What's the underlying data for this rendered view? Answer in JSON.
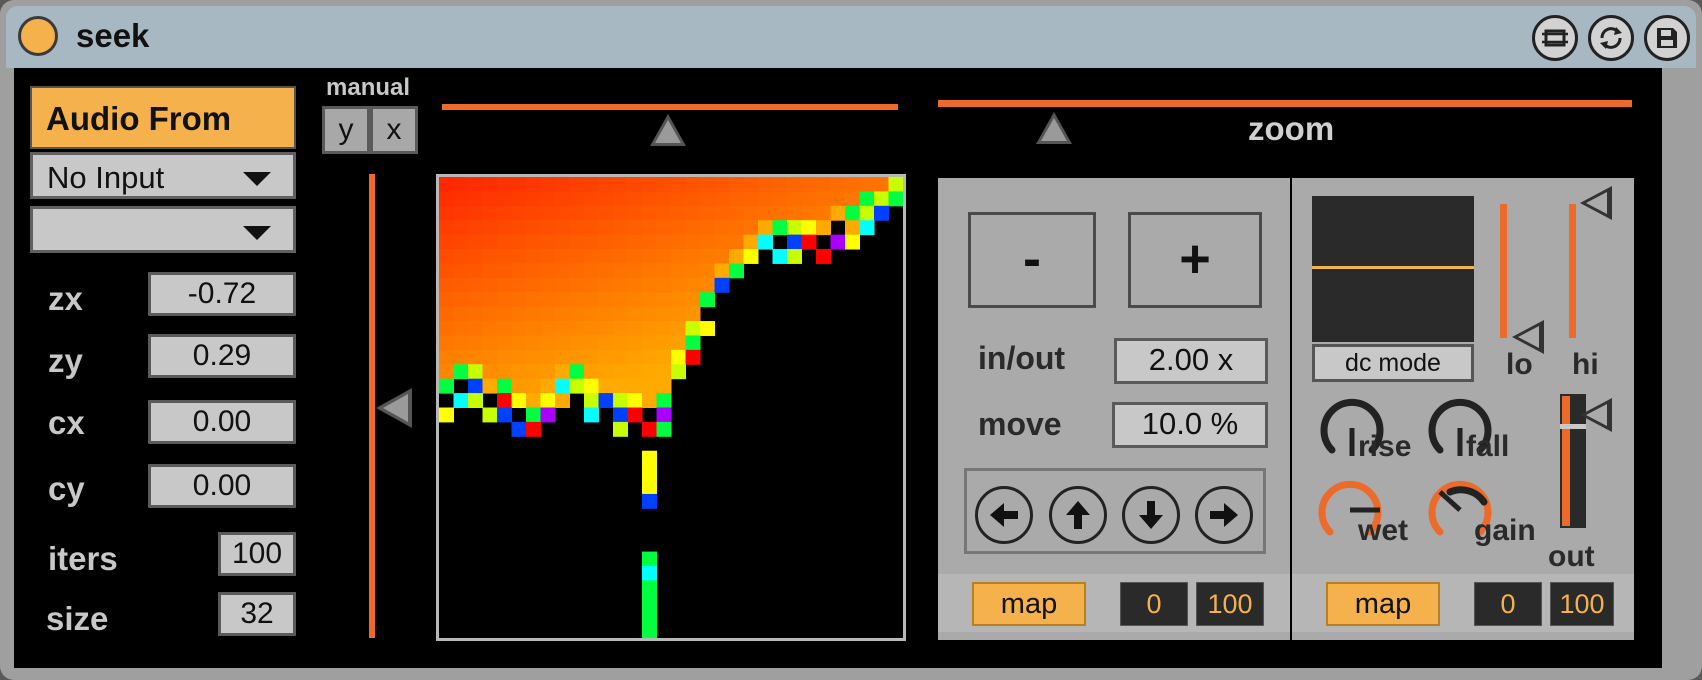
{
  "device": {
    "title": "seek"
  },
  "titlebar": {
    "icons": [
      "hot-swap-icon",
      "presets-icon",
      "save-icon"
    ]
  },
  "source": {
    "header": "Audio From",
    "input_menu": "No Input",
    "channel_menu": ""
  },
  "params": {
    "zx": {
      "label": "zx",
      "value": "-0.72"
    },
    "zy": {
      "label": "zy",
      "value": "0.29"
    },
    "cx": {
      "label": "cx",
      "value": "0.00"
    },
    "cy": {
      "label": "cy",
      "value": "0.00"
    },
    "iters": {
      "label": "iters",
      "value": "100"
    },
    "size": {
      "label": "size",
      "value": "32"
    }
  },
  "manual": {
    "label": "manual",
    "y_label": "y",
    "x_label": "x"
  },
  "zoom": {
    "label": "zoom",
    "minus_label": "-",
    "plus_label": "+",
    "inout_label": "in/out",
    "inout_value": "2.00 x",
    "move_label": "move",
    "move_value": "10.0 %",
    "arrows": [
      "arrow-left-icon",
      "arrow-up-icon",
      "arrow-down-icon",
      "arrow-right-icon"
    ],
    "map_label": "map",
    "map_min": "0",
    "map_max": "100"
  },
  "dc": {
    "mode_label": "dc mode",
    "lo_label": "lo",
    "hi_label": "hi",
    "rise_label": "rise",
    "fall_label": "fall",
    "wet_label": "wet",
    "gain_label": "gain",
    "out_label": "out",
    "map_label": "map",
    "map_min": "0",
    "map_max": "100"
  },
  "colors": {
    "accent": "#f5b14c",
    "orange": "#ed6b2a",
    "panel": "#aaaaaa",
    "title_bar": "#a7b8c2"
  }
}
